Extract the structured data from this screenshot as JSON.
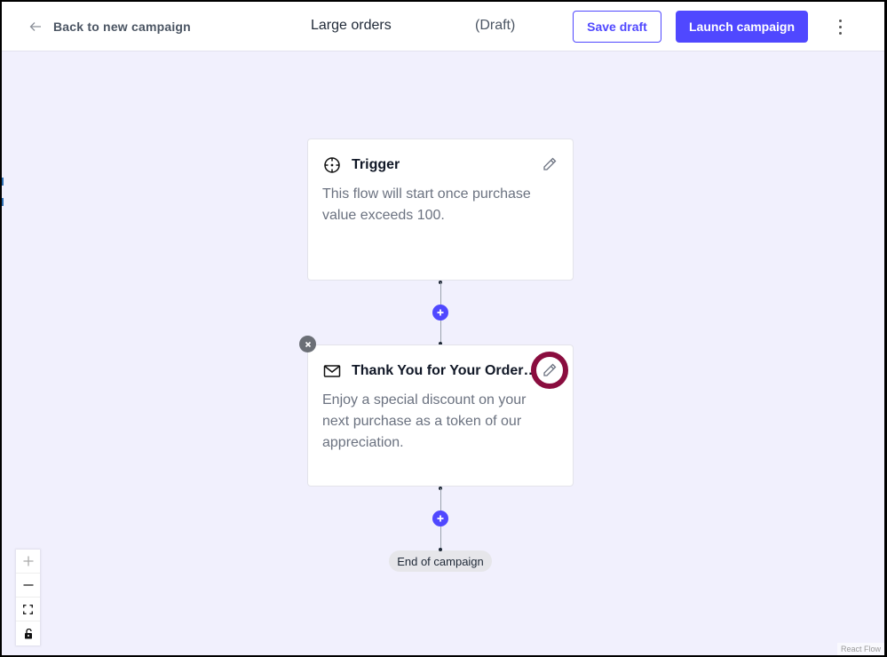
{
  "header": {
    "back_label": "Back to new campaign",
    "title": "Large orders",
    "status": "(Draft)",
    "save_draft_label": "Save draft",
    "launch_label": "Launch campaign",
    "more_icon": "more-vertical-icon"
  },
  "colors": {
    "accent": "#5048ff",
    "canvas_bg": "#f1f0fd",
    "highlight": "#8a0d3f"
  },
  "flow": {
    "nodes": [
      {
        "type": "trigger",
        "icon": "crosshair-icon",
        "title": "Trigger",
        "description": "This flow will start once purchase value exceeds 100.",
        "edit_icon": "pencil-icon"
      },
      {
        "type": "email",
        "icon": "mail-icon",
        "title": "Thank You for Your Order! …",
        "description": "Enjoy a special discount on your next purchase as a token of our appreciation.",
        "edit_icon": "pencil-icon",
        "delete_icon": "close-icon",
        "edit_highlighted": true
      }
    ],
    "add_icon": "plus-icon",
    "end_label": "End of campaign"
  },
  "controls": {
    "zoom_in": "plus-icon",
    "zoom_out": "minus-icon",
    "fit_view": "fit-view-icon",
    "lock": "unlock-icon"
  },
  "attribution": "React Flow"
}
